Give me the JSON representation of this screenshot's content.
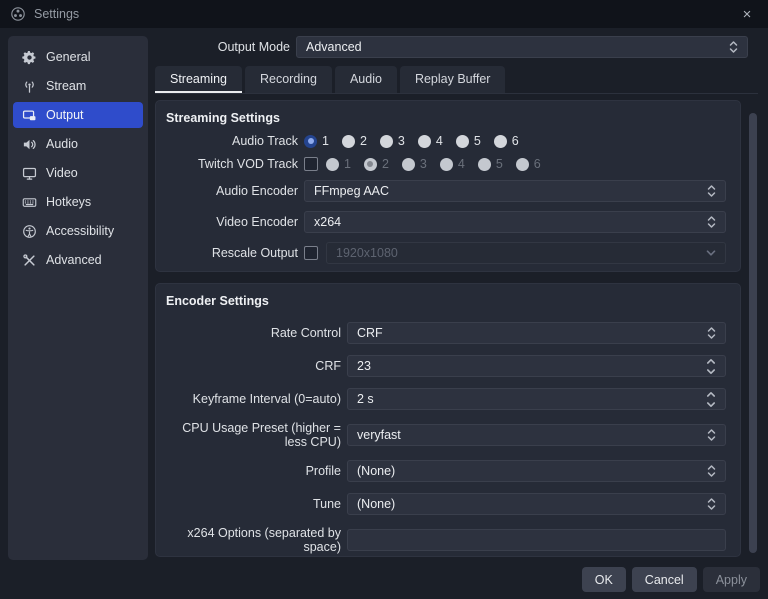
{
  "window": {
    "title": "Settings",
    "close_glyph": "×"
  },
  "sidebar": {
    "selected": "Output",
    "items": [
      {
        "label": "General",
        "icon": "gear-icon"
      },
      {
        "label": "Stream",
        "icon": "broadcast-icon"
      },
      {
        "label": "Output",
        "icon": "output-icon"
      },
      {
        "label": "Audio",
        "icon": "speaker-icon"
      },
      {
        "label": "Video",
        "icon": "monitor-icon"
      },
      {
        "label": "Hotkeys",
        "icon": "keyboard-icon"
      },
      {
        "label": "Accessibility",
        "icon": "accessibility-icon"
      },
      {
        "label": "Advanced",
        "icon": "tools-icon"
      }
    ]
  },
  "output_mode": {
    "label": "Output Mode",
    "value": "Advanced"
  },
  "tabs": {
    "items": [
      {
        "label": "Streaming",
        "active": true
      },
      {
        "label": "Recording",
        "active": false
      },
      {
        "label": "Audio",
        "active": false
      },
      {
        "label": "Replay Buffer",
        "active": false
      }
    ]
  },
  "streaming": {
    "title": "Streaming Settings",
    "audio_track": {
      "label": "Audio Track",
      "selected": "1",
      "options": [
        "1",
        "2",
        "3",
        "4",
        "5",
        "6"
      ]
    },
    "twitch_vod": {
      "label": "Twitch VOD Track",
      "checkbox_checked": false,
      "disabled": true,
      "selected": "2",
      "options": [
        "1",
        "2",
        "3",
        "4",
        "5",
        "6"
      ]
    },
    "audio_encoder": {
      "label": "Audio Encoder",
      "value": "FFmpeg AAC"
    },
    "video_encoder": {
      "label": "Video Encoder",
      "value": "x264"
    },
    "rescale": {
      "label": "Rescale Output",
      "checkbox_checked": false,
      "disabled": true,
      "value": "1920x1080"
    }
  },
  "encoder": {
    "title": "Encoder Settings",
    "rate_control": {
      "label": "Rate Control",
      "value": "CRF",
      "type": "combo"
    },
    "crf": {
      "label": "CRF",
      "value": "23",
      "type": "spinbox"
    },
    "keyframe": {
      "label": "Keyframe Interval (0=auto)",
      "value": "2 s",
      "type": "spinbox"
    },
    "cpu_preset": {
      "label": "CPU Usage Preset (higher = less CPU)",
      "value": "veryfast",
      "type": "combo"
    },
    "profile": {
      "label": "Profile",
      "value": "(None)",
      "type": "combo"
    },
    "tune": {
      "label": "Tune",
      "value": "(None)",
      "type": "combo"
    },
    "x264opts": {
      "label": "x264 Options (separated by space)",
      "value": "",
      "type": "text"
    }
  },
  "footer": {
    "ok": "OK",
    "cancel": "Cancel",
    "apply": "Apply",
    "apply_disabled": true
  },
  "colors": {
    "accent_blue": "#2f4ccb",
    "window_bg": "#1b1f28",
    "titlebar_bg": "#10131a",
    "panel_bg": "#262b37",
    "field_bg": "#2d323f",
    "radio_checked_ring": "#24448f",
    "radio_checked_dot": "#8fabee",
    "text": "#e8eaed",
    "active_tab_underline": "#e9ebee"
  }
}
